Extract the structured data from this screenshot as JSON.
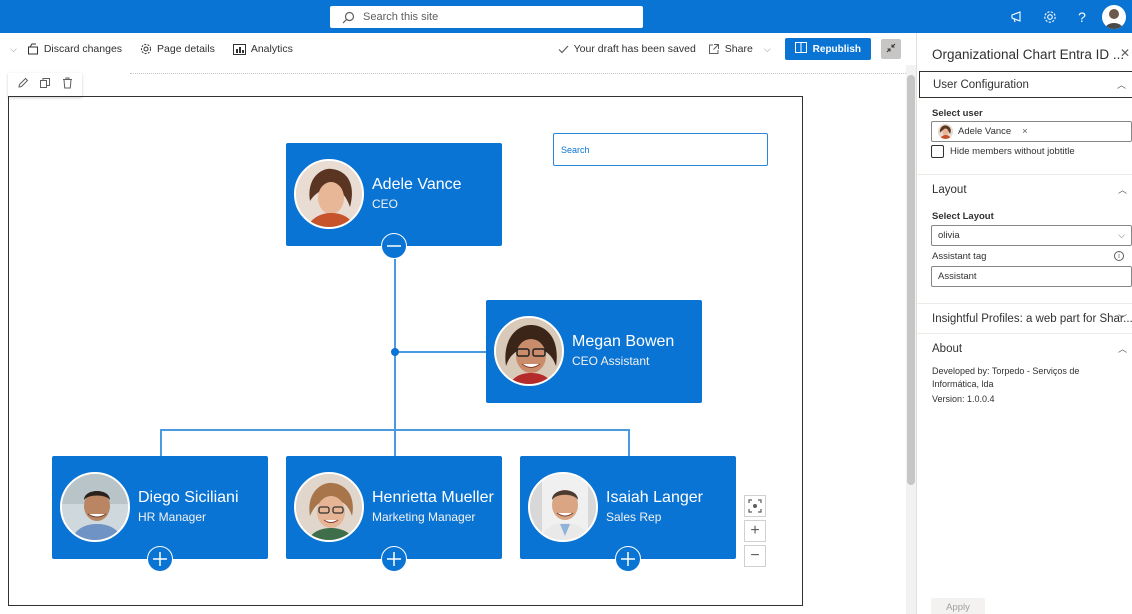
{
  "suite": {
    "search_placeholder": "Search this site",
    "icons": [
      "megaphone-icon",
      "gear-icon",
      "help-icon",
      "avatar"
    ]
  },
  "commandbar": {
    "discard_label": "Discard changes",
    "page_details_label": "Page details",
    "analytics_label": "Analytics",
    "draft_status": "Your draft has been saved",
    "share_label": "Share",
    "republish_label": "Republish"
  },
  "canvas": {
    "search_placeholder": "Search",
    "nodes": {
      "root": {
        "name": "Adele Vance",
        "title": "CEO"
      },
      "assistant": {
        "name": "Megan Bowen",
        "title": "CEO Assistant"
      },
      "child1": {
        "name": "Diego Siciliani",
        "title": "HR Manager"
      },
      "child2": {
        "name": "Henrietta Mueller",
        "title": "Marketing Manager"
      },
      "child3": {
        "name": "Isaiah Langer",
        "title": "Sales Rep"
      }
    }
  },
  "pane": {
    "title": "Organizational Chart Entra ID ...",
    "user_config": {
      "header": "User Configuration",
      "select_user_label": "Select user",
      "selected_user": "Adele Vance",
      "hide_members_label": "Hide members without jobtitle"
    },
    "layout": {
      "header": "Layout",
      "select_layout_label": "Select Layout",
      "select_layout_value": "olivia",
      "assistant_tag_label": "Assistant tag",
      "assistant_tag_value": "Assistant"
    },
    "insightful_header": "Insightful Profiles: a web part for Shar...",
    "about": {
      "header": "About",
      "developed_by": "Developed by: Torpedo - Serviços de Informática, lda",
      "version": "Version: 1.0.0.4"
    },
    "apply_label": "Apply"
  },
  "colors": {
    "brand": "#0a74d4",
    "card": "#0a74d4",
    "connector": "#4a9ae0"
  }
}
